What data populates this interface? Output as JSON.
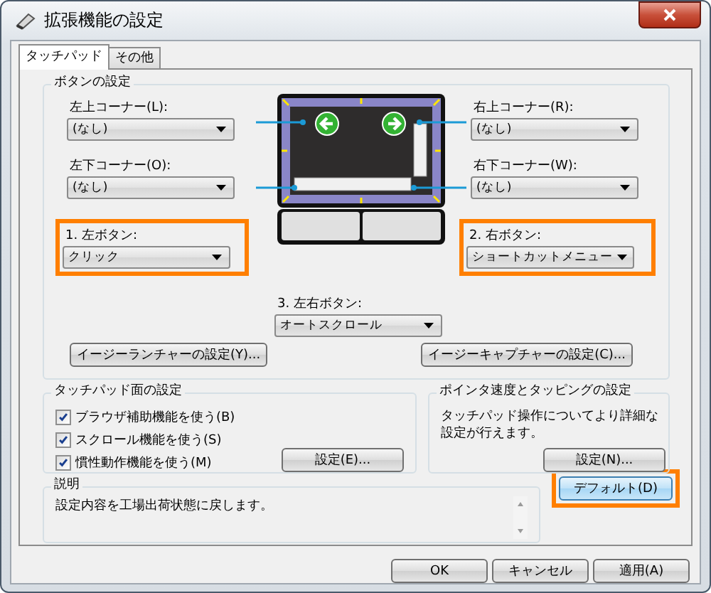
{
  "window": {
    "title": "拡張機能の設定"
  },
  "tabs": [
    {
      "label": "タッチパッド",
      "selected": true
    },
    {
      "label": "その他",
      "selected": false
    }
  ],
  "button_settings": {
    "title": "ボタンの設定",
    "corners": [
      {
        "label": "左上コーナー(L):",
        "value": "(なし)"
      },
      {
        "label": "右上コーナー(R):",
        "value": "(なし)"
      },
      {
        "label": "左下コーナー(O):",
        "value": "(なし)"
      },
      {
        "label": "右下コーナー(W):",
        "value": "(なし)"
      }
    ],
    "buttons": [
      {
        "label": "1. 左ボタン:",
        "value": "クリック",
        "highlighted": true
      },
      {
        "label": "2. 右ボタン:",
        "value": "ショートカットメニュー",
        "highlighted": true
      },
      {
        "label": "3. 左右ボタン:",
        "value": "オートスクロール",
        "highlighted": false
      }
    ],
    "actions": [
      {
        "label": "イージーランチャーの設定(Y)..."
      },
      {
        "label": "イージーキャプチャーの設定(C)..."
      }
    ]
  },
  "surface_settings": {
    "title": "タッチパッド面の設定",
    "options": [
      {
        "label": "ブラウザ補助機能を使う(B)",
        "checked": true
      },
      {
        "label": "スクロール機能を使う(S)",
        "checked": true
      },
      {
        "label": "慣性動作機能を使う(M)",
        "checked": true
      }
    ],
    "button": "設定(E)..."
  },
  "pointer_settings": {
    "title": "ポインタ速度とタッピングの設定",
    "text": "タッチパッド操作についてより詳細な設定が行えます。",
    "button": "設定(N)..."
  },
  "description": {
    "title": "説明",
    "text": "設定内容を工場出荷状態に戻します。"
  },
  "default_button": {
    "label": "デフォルト(D)",
    "highlighted": true
  },
  "footer_buttons": [
    "OK",
    "キャンセル",
    "適用(A)"
  ]
}
